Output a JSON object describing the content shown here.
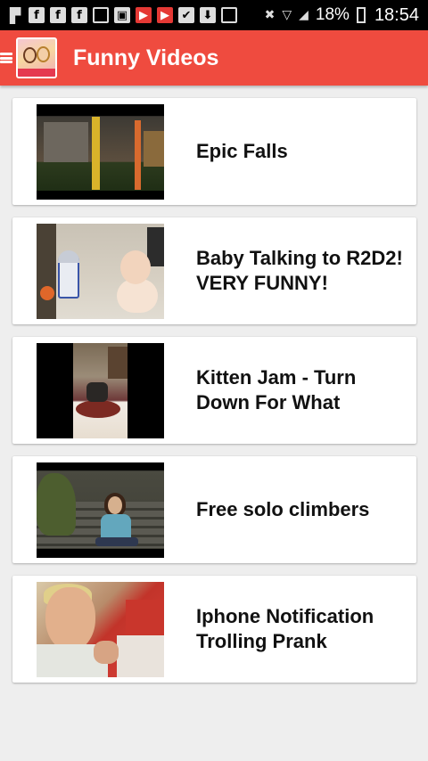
{
  "status_bar": {
    "notification_icons": [
      {
        "icon": "flipboard-icon",
        "glyph": "▛",
        "style": "flat"
      },
      {
        "icon": "facebook-icon",
        "glyph": "f",
        "style": "plain"
      },
      {
        "icon": "facebook-icon",
        "glyph": "f",
        "style": "plain"
      },
      {
        "icon": "facebook-icon",
        "glyph": "f",
        "style": "plain"
      },
      {
        "icon": "message-icon",
        "glyph": "□",
        "style": "box"
      },
      {
        "icon": "app-icon",
        "glyph": "▣",
        "style": "plain"
      },
      {
        "icon": "youtube-icon",
        "glyph": "▶",
        "style": "red"
      },
      {
        "icon": "youtube-icon",
        "glyph": "▶",
        "style": "red"
      },
      {
        "icon": "bag-icon",
        "glyph": "✔",
        "style": "plain"
      },
      {
        "icon": "bag-icon",
        "glyph": "⬇",
        "style": "plain"
      },
      {
        "icon": "download-icon",
        "glyph": "✔",
        "style": "box"
      }
    ],
    "system_icons": [
      {
        "icon": "mute-icon",
        "glyph": "✖"
      },
      {
        "icon": "wifi-icon",
        "glyph": "▽"
      },
      {
        "icon": "signal-icon",
        "glyph": "◢"
      }
    ],
    "battery_percent": "18%",
    "time": "18:54"
  },
  "app_bar": {
    "title": "Funny Videos",
    "background": "#ef4b3f"
  },
  "videos": [
    {
      "title_lines": [
        "Epic Falls",
        ""
      ],
      "thumb": "t1"
    },
    {
      "title_lines": [
        "Baby Talking to R2D2!",
        "VERY FUNNY!"
      ],
      "thumb": "t2"
    },
    {
      "title_lines": [
        "Kitten Jam - Turn",
        "Down For What"
      ],
      "thumb": "t3"
    },
    {
      "title_lines": [
        "Free solo climbers",
        ""
      ],
      "thumb": "t4"
    },
    {
      "title_lines": [
        "Iphone Notification",
        "Trolling Prank"
      ],
      "thumb": "t5"
    }
  ]
}
